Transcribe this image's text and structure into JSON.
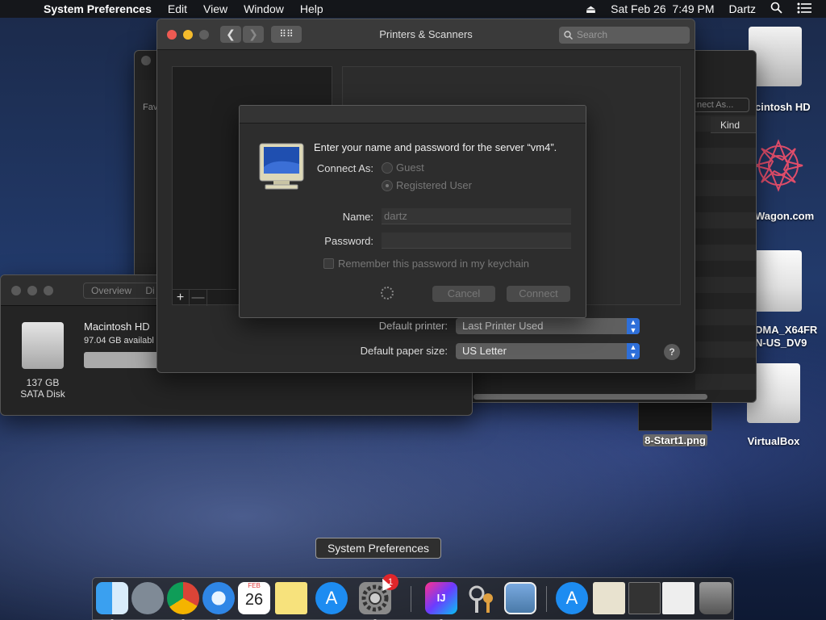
{
  "menubar": {
    "app_name": "System Preferences",
    "menus": [
      "Edit",
      "View",
      "Window",
      "Help"
    ],
    "clock": "Sat Feb 26  7:49 PM",
    "user": "Dartz"
  },
  "printers_window": {
    "title": "Printers & Scanners",
    "search_placeholder": "Search",
    "default_printer_label": "Default printer:",
    "default_printer_value": "Last Printer Used",
    "paper_size_label": "Default paper size:",
    "paper_size_value": "US Letter",
    "add_label": "+",
    "remove_label": "—",
    "help_label": "?"
  },
  "auth_dialog": {
    "message": "Enter your name and password for the server “vm4”.",
    "connect_as_label": "Connect As:",
    "guest_label": "Guest",
    "registered_label": "Registered User",
    "name_label": "Name:",
    "name_value": "dartz",
    "password_label": "Password:",
    "password_value": "",
    "remember_label": "Remember this password in my keychain",
    "cancel_label": "Cancel",
    "connect_label": "Connect"
  },
  "finder_window": {
    "favorites_label": "Fav",
    "connect_as_button": "nect As...",
    "kind_header": "Kind"
  },
  "disk_window": {
    "tab_overview": "Overview",
    "tab_partial": "Di",
    "disk_name": "Macintosh HD",
    "available": "97.04 GB availabl",
    "size": "137 GB",
    "type": "SATA Disk"
  },
  "desktop": {
    "icons": [
      {
        "label": "cintosh HD"
      },
      {
        "label": "Wagon.com"
      },
      {
        "label": "DMA_X64FR\nN-US_DV9"
      },
      {
        "label": "8-Start1.png"
      },
      {
        "label": "VirtualBox"
      }
    ]
  },
  "tooltip": "System Preferences",
  "dock": {
    "items": [
      "Finder",
      "Launchpad",
      "Chrome",
      "Safari",
      "Calendar",
      "Notes",
      "App Store",
      "System Preferences",
      "IntelliJ IDEA",
      "Keychain Access",
      "Preview",
      "App Store",
      "Documents",
      "Screenshots",
      "Downloads",
      "Trash"
    ],
    "badge_count": "1",
    "calendar_month": "FEB",
    "calendar_day": "26"
  }
}
